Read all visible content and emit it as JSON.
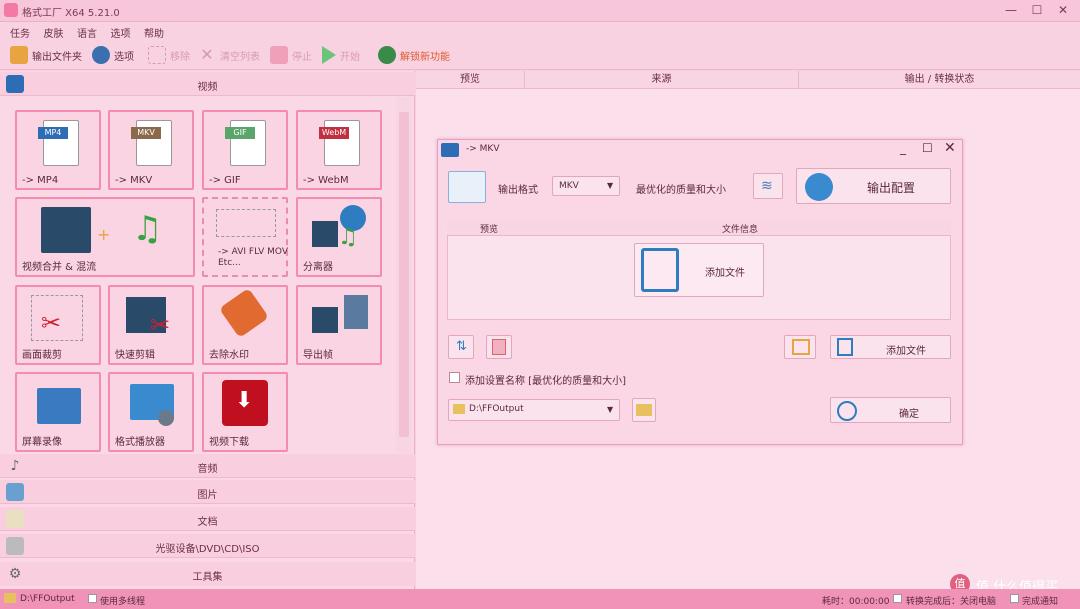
{
  "window": {
    "title": "格式工厂 X64 5.21.0"
  },
  "menu": [
    "任务",
    "皮肤",
    "语言",
    "选项",
    "帮助"
  ],
  "toolbar": {
    "output_folder": "输出文件夹",
    "options": "选项",
    "remove": "移除",
    "clear_list": "清空列表",
    "stop": "停止",
    "start": "开始",
    "download_label": "解锁新功能"
  },
  "categories": {
    "video": "视频",
    "audio": "音频",
    "image": "图片",
    "document": "文档",
    "disc": "光驱设备\\DVD\\CD\\ISO",
    "toolbox": "工具集"
  },
  "tiles": [
    {
      "label": "-> MP4",
      "tag": "MP4"
    },
    {
      "label": "-> MKV",
      "tag": "MKV"
    },
    {
      "label": "-> GIF",
      "tag": "GIF"
    },
    {
      "label": "-> WebM",
      "tag": "WebM"
    },
    {
      "label": "视频合并 & 混流"
    },
    {
      "label": "-> AVI FLV MOV Etc..."
    },
    {
      "label": "分离器"
    },
    {
      "label": "画面裁剪"
    },
    {
      "label": "快速剪辑"
    },
    {
      "label": "去除水印"
    },
    {
      "label": "导出帧"
    },
    {
      "label": "屏幕录像"
    },
    {
      "label": "格式播放器"
    },
    {
      "label": "视频下载"
    }
  ],
  "columns": {
    "preview": "预览",
    "source": "来源",
    "output": "输出 / 转换状态"
  },
  "dialog": {
    "title": "-> MKV",
    "output_format_label": "输出格式",
    "format_value": "MKV",
    "quality_label": "最优化的质量和大小",
    "config_button": "输出配置",
    "col_preview": "预览",
    "col_file": "文件信息",
    "add_file_big": "添加文件",
    "add_file_button": "添加文件",
    "checkbox_label": "添加设置名称 [最优化的质量和大小]",
    "output_path": "D:\\FFOutput",
    "ok_button": "确定"
  },
  "statusbar": {
    "path": "D:\\FFOutput",
    "multithread": "使用多线程",
    "elapsed": "耗时：00:00:00",
    "after_done": "转换完成后：关闭电脑",
    "notify": "完成通知"
  },
  "watermark": "值 什么值得买",
  "colors": {
    "accent": "#f48bb2",
    "bg": "#f9cfe0",
    "status": "#f193b9"
  }
}
